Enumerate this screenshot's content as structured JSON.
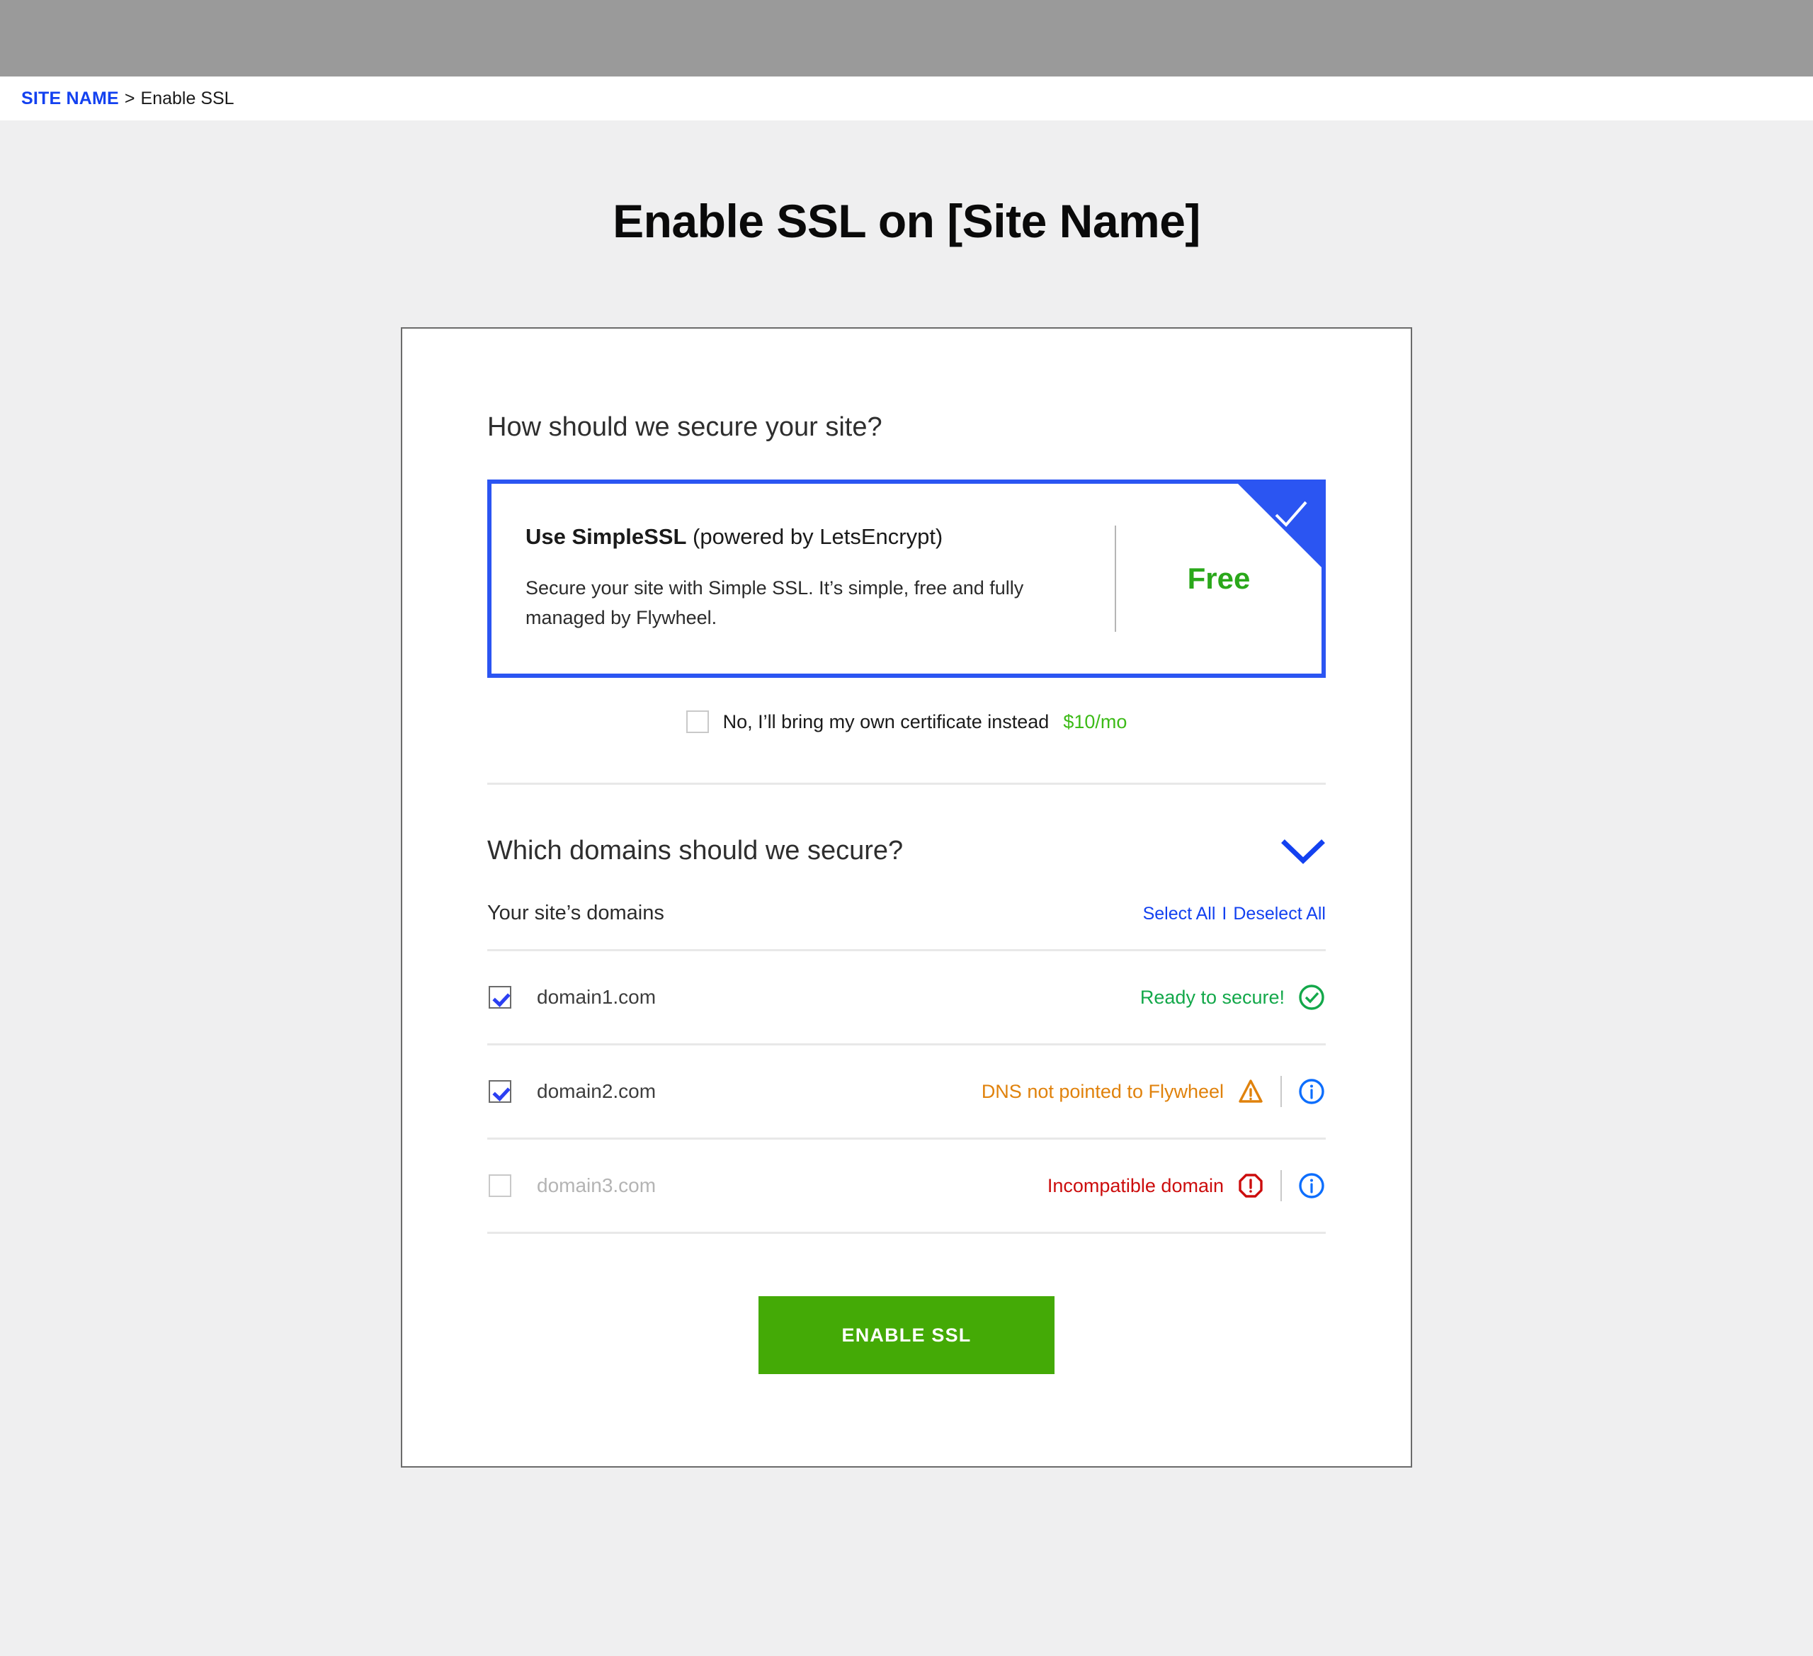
{
  "breadcrumb": {
    "site_label": "SITE NAME",
    "separator": ">",
    "current": "Enable SSL"
  },
  "page": {
    "title": "Enable SSL on [Site Name]"
  },
  "colors": {
    "accent_blue": "#1341f0",
    "card_border_blue": "#2b55f2",
    "free_green": "#2aa81a",
    "price_green": "#3dbb18",
    "button_green": "#44aa06",
    "status_ok_green": "#13a84a",
    "status_warn_orange": "#e0820c",
    "status_error_red": "#cc0d0d",
    "top_bar_gray": "#9a9a9a",
    "page_bg": "#efeff0"
  },
  "secure_section": {
    "heading": "How should we secure your site?",
    "option": {
      "title_strong": "Use SimpleSSL",
      "title_rest": " (powered by LetsEncrypt)",
      "description": "Secure your site with Simple SSL. It’s simple, free and fully managed by Flywheel.",
      "price": "Free",
      "selected": true
    },
    "own_cert": {
      "label": "No, I’ll bring my own certificate instead",
      "price": "$10/mo",
      "checked": false
    }
  },
  "domains_section": {
    "heading": "Which domains should we secure?",
    "subheading": "Your site’s domains",
    "select_all": "Select All",
    "pipe": "I",
    "deselect_all": "Deselect All",
    "rows": [
      {
        "name": "domain1.com",
        "checked": true,
        "disabled": false,
        "status": "Ready to secure!",
        "status_kind": "ok",
        "has_info": false
      },
      {
        "name": "domain2.com",
        "checked": true,
        "disabled": false,
        "status": "DNS not pointed to Flywheel",
        "status_kind": "warn",
        "has_info": true
      },
      {
        "name": "domain3.com",
        "checked": false,
        "disabled": true,
        "status": "Incompatible domain",
        "status_kind": "error",
        "has_info": true
      }
    ]
  },
  "submit": {
    "label": "ENABLE SSL"
  }
}
